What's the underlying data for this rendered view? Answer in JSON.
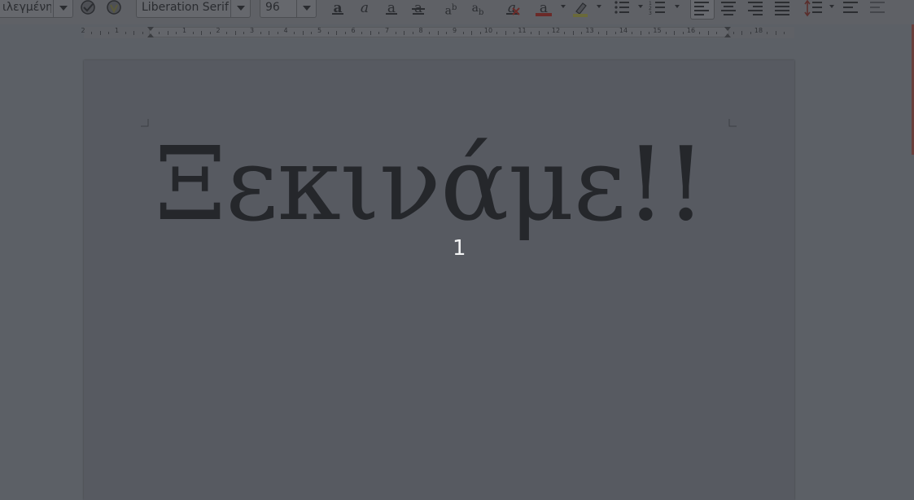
{
  "toolbar": {
    "paragraph_style": "ιλεγμένη",
    "font_name": "Liberation Serif",
    "font_size": "96",
    "icons": [
      "spell-check-icon",
      "auto-spellcheck-icon",
      "bold-icon",
      "italic-icon",
      "underline-icon",
      "strikethrough-icon",
      "superscript-icon",
      "subscript-icon",
      "clear-formatting-icon",
      "font-color-icon",
      "highlight-icon",
      "bullet-list-icon",
      "numbered-list-icon",
      "align-left-icon",
      "align-center-icon",
      "align-right-icon",
      "justify-icon",
      "line-spacing-icon",
      "increase-paragraph-spacing-icon",
      "decrease-paragraph-spacing-icon"
    ],
    "colors": {
      "font_color_bar": "#c9211e",
      "highlight_bar": "#e8e84a"
    }
  },
  "ruler": {
    "left_labels": [
      "2",
      "1"
    ],
    "labels": [
      "1",
      "2",
      "3",
      "4",
      "5",
      "6",
      "7",
      "8",
      "9",
      "10",
      "11",
      "12",
      "13",
      "14",
      "15",
      "16"
    ],
    "end_label": "18"
  },
  "document": {
    "heading_text": "Ξεκινάμε!!",
    "page_overlay_number": "1"
  }
}
